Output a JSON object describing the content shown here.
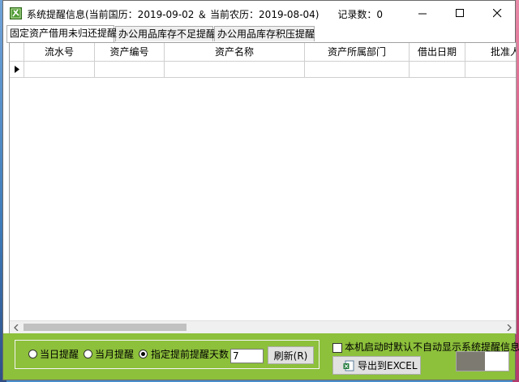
{
  "window": {
    "title": "系统提醒信息(当前国历：2019-09-02 ＆ 当前农历：2019-08-04)",
    "record_count": "记录数：0"
  },
  "tabs": [
    {
      "label": "固定资产借用未归还提醒",
      "active": true
    },
    {
      "label": "办公用品库存不足提醒",
      "active": false
    },
    {
      "label": "办公用品库存积压提醒",
      "active": false
    }
  ],
  "grid": {
    "columns": [
      "流水号",
      "资产编号",
      "资产名称",
      "资产所属部门",
      "借出日期",
      "批准人"
    ],
    "rows": [
      [
        "",
        "",
        "",
        "",
        "",
        ""
      ]
    ]
  },
  "options": {
    "today": "当日提醒",
    "month": "当月提醒",
    "advance": "指定提前提醒天数：",
    "selected": "advance",
    "days_value": "7",
    "refresh": "刷新(R)",
    "startup_checkbox": "本机启动时默认不自动显示系统提醒信息",
    "startup_checked": false,
    "export": "导出到EXCEL"
  },
  "progress": {
    "value": 0.55
  },
  "colors": {
    "bottom_bar": "#8dc03b",
    "app_icon": "#4e9b32"
  },
  "icons": {
    "app": "app-logo-icon",
    "minimize": "minimize-icon",
    "maximize": "maximize-icon",
    "close": "close-icon",
    "row_pointer": "row-pointer-icon",
    "excel": "excel-icon"
  }
}
